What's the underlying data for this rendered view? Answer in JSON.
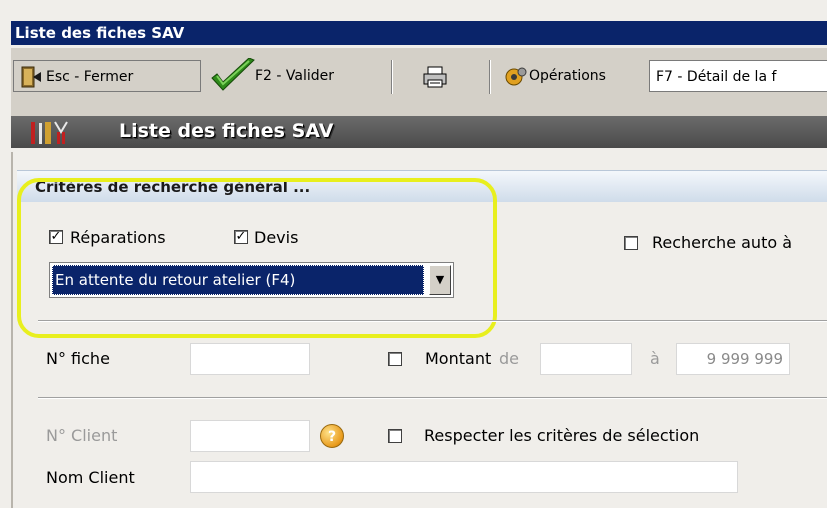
{
  "window": {
    "title": "Liste des fiches SAV"
  },
  "toolbar": {
    "close_label": "Esc - Fermer",
    "validate_label": "F2 - Valider",
    "operations_label": "Opérations",
    "detail_label": "F7 - Détail de la f"
  },
  "header": {
    "title": "Liste des fiches SAV"
  },
  "section": {
    "title": "Critères de recherche général ..."
  },
  "filters": {
    "reparations": {
      "label": "Réparations",
      "checked": true
    },
    "devis": {
      "label": "Devis",
      "checked": true
    },
    "auto_search": {
      "label": "Recherche auto à",
      "checked": false
    },
    "status_select": {
      "value": "En attente du retour atelier (F4)"
    }
  },
  "form": {
    "fiche_label": "N° fiche",
    "montant": {
      "label": "Montant",
      "from_label": "de",
      "to_label": "à",
      "to_value": "9 999 999",
      "checked": false
    },
    "client_label": "N° Client",
    "respect": {
      "label": "Respecter les critères de sélection",
      "checked": false
    },
    "nom_client_label": "Nom Client"
  },
  "colors": {
    "title_bar": "#0a246a",
    "highlight": "#e8ef1e",
    "selected": "#0a246a"
  }
}
